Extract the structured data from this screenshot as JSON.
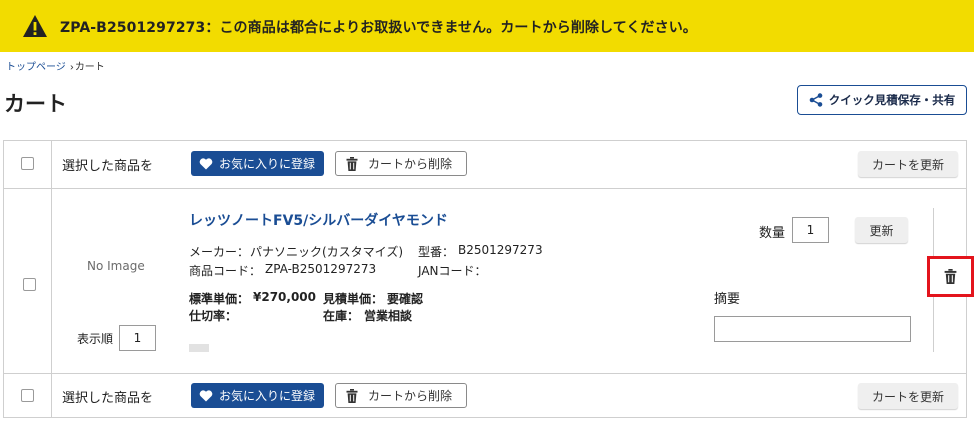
{
  "alert": {
    "icon": "warning-icon",
    "message": "ZPA-B2501297273：この商品は都合によりお取扱いできません。カートから削除してください。",
    "background": "#f2dc00"
  },
  "breadcrumb": {
    "items": [
      "トップページ",
      "カート"
    ],
    "separator": "›"
  },
  "page": {
    "title": "カート",
    "share_button": "クイック見積保存・共有",
    "accent": "#1a4d94"
  },
  "bulk_bar": {
    "label": "選択した商品を",
    "favorite_button": "お気に入りに登録",
    "remove_button": "カートから削除",
    "update_button": "カートを更新"
  },
  "item": {
    "image_placeholder": "No Image",
    "name": "レッツノートFV5/シルバーダイヤモンド",
    "maker_label": "メーカー：",
    "maker_value": "パナソニック(カスタマイズ)",
    "model_label": "型番：",
    "model_value": "B2501297273",
    "code_label": "商品コード：",
    "code_value": "ZPA-B2501297273",
    "jan_label": "JANコード：",
    "jan_value": "",
    "std_price_label": "標準単価：",
    "std_price_value": "¥270,000",
    "quote_price_label": "見積単価：",
    "quote_price_value": "要確認",
    "wholesale_label": "仕切率：",
    "wholesale_value": "",
    "stock_label": "在庫：",
    "stock_value": "営業相談",
    "order_label": "表示順",
    "order_value": "1",
    "qty_label": "数量",
    "qty_value": "1",
    "update_button": "更新",
    "note_label": "摘要",
    "note_value": "",
    "delete_icon": "trash-icon",
    "highlight_color": "#e3141c"
  }
}
